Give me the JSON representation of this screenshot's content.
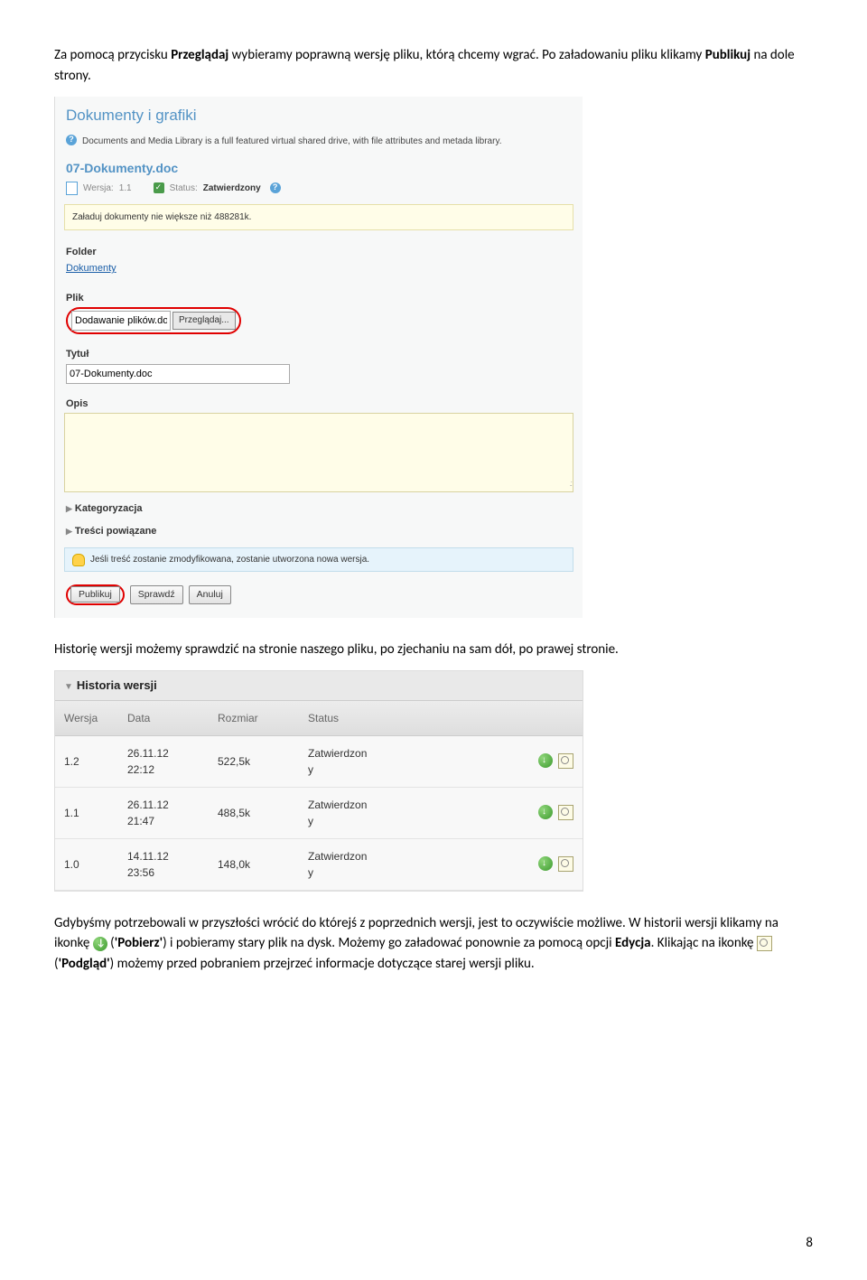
{
  "para1_a": "Za pomocą przycisku ",
  "para1_b": "Przeglądaj",
  "para1_c": " wybieramy poprawną wersję pliku, którą chcemy wgrać. Po załadowaniu pliku klikamy ",
  "para1_d": "Publikuj",
  "para1_e": " na dole strony.",
  "shot1": {
    "heading": "Dokumenty i grafiki",
    "desc": "Documents and Media Library is a full featured virtual shared drive, with file attributes and metada library.",
    "docname": "07-Dokumenty.doc",
    "version_label": "Wersja:",
    "version": "1.1",
    "status_label": "Status:",
    "status_value": "Zatwierdzony",
    "upload_msg": "Załaduj dokumenty nie większe niż 488281k.",
    "folder_label": "Folder",
    "folder_value": "Dokumenty",
    "file_label": "Plik",
    "file_value": "Dodawanie plików.doc",
    "browse_btn": "Przeglądaj...",
    "title_label": "Tytuł",
    "title_value": "07-Dokumenty.doc",
    "opis_label": "Opis",
    "cat_label": "Kategoryzacja",
    "related_label": "Treści powiązane",
    "info_msg": "Jeśli treść zostanie zmodyfikowana, zostanie utworzona nowa wersja.",
    "btn_publish": "Publikuj",
    "btn_check": "Sprawdź",
    "btn_cancel": "Anuluj"
  },
  "para2": "Historię wersji możemy sprawdzić na stronie naszego pliku, po zjechaniu na sam dół, po prawej stronie.",
  "shot2": {
    "title": "Historia wersji",
    "cols": {
      "c1": "Wersja",
      "c2": "Data",
      "c3": "Rozmiar",
      "c4": "Status"
    },
    "rows": [
      {
        "v": "1.2",
        "d1": "26.11.12",
        "d2": "22:12",
        "s": "522,5k",
        "st1": "Zatwierdzon",
        "st2": "y"
      },
      {
        "v": "1.1",
        "d1": "26.11.12",
        "d2": "21:47",
        "s": "488,5k",
        "st1": "Zatwierdzon",
        "st2": "y"
      },
      {
        "v": "1.0",
        "d1": "14.11.12",
        "d2": "23:56",
        "s": "148,0k",
        "st1": "Zatwierdzon",
        "st2": "y"
      }
    ]
  },
  "para3_a": "Gdybyśmy potrzebowali w przyszłości wrócić do którejś z poprzednich wersji, jest to oczywiście możliwe. W historii wersji klikamy na ikonkę ",
  "para3_b": " (",
  "para3_c": "'Pobierz'",
  "para3_d": ") i pobieramy stary plik na dysk. Możemy go załadować ponownie za pomocą opcji ",
  "para3_e": "Edycja",
  "para3_f": ". Klikając na ikonkę ",
  "para3_g": " (",
  "para3_h": "'Podgląd'",
  "para3_i": ") możemy przed pobraniem przejrzeć informacje dotyczące starej wersji pliku.",
  "pagenum": "8"
}
